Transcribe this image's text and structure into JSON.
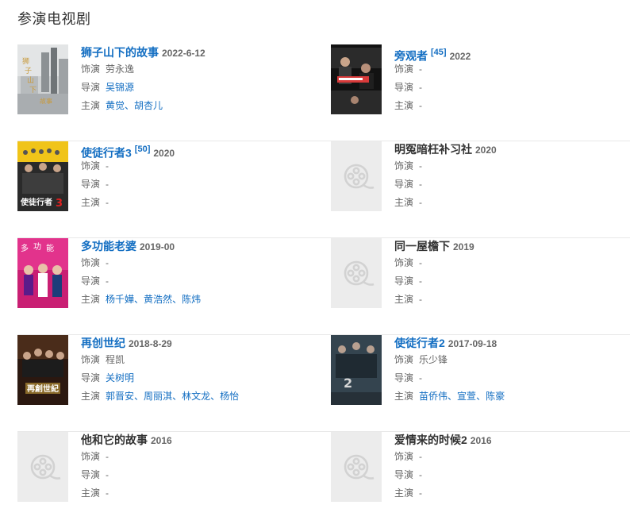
{
  "section": {
    "title": "参演电视剧"
  },
  "labels": {
    "role": "饰演",
    "director": "导演",
    "cast": "主演"
  },
  "dramas": [
    {
      "title": "狮子山下的故事",
      "ref": "",
      "date": "2022-6-12",
      "role": "劳永逸",
      "director": "吴锦源",
      "cast": [
        "黄觉",
        "胡杏儿"
      ],
      "poster": "lion-rock"
    },
    {
      "title": "旁观者",
      "ref": "[45]",
      "date": "2022",
      "role": "-",
      "director": "-",
      "cast": [
        "-"
      ],
      "poster": "bystander"
    },
    {
      "title": "使徒行者3",
      "ref": "[50]",
      "date": "2020",
      "role": "-",
      "director": "-",
      "cast": [
        "-"
      ],
      "poster": "line-walker-3"
    },
    {
      "title": "明冤暗枉补习社",
      "ref": "",
      "date": "2020",
      "role": "-",
      "director": "-",
      "cast": [
        "-"
      ],
      "poster": "placeholder"
    },
    {
      "title": "多功能老婆",
      "ref": "",
      "date": "2019-00",
      "role": "-",
      "director": "-",
      "cast": [
        "杨千嬅",
        "黄浩然",
        "陈炜"
      ],
      "poster": "wife"
    },
    {
      "title": "同一屋檐下",
      "ref": "",
      "date": "2019",
      "role": "-",
      "director": "-",
      "cast": [
        "-"
      ],
      "poster": "placeholder"
    },
    {
      "title": "再创世纪",
      "ref": "",
      "date": "2018-8-29",
      "role": "程凯",
      "director": "关树明",
      "cast": [
        "郭晋安",
        "周丽淇",
        "林文龙",
        "杨怡"
      ],
      "poster": "another-era"
    },
    {
      "title": "使徒行者2",
      "ref": "",
      "date": "2017-09-18",
      "role": "乐少锋",
      "director": "-",
      "cast": [
        "苗侨伟",
        "宣萱",
        "陈豪"
      ],
      "poster": "line-walker-2"
    },
    {
      "title": "他和它的故事",
      "ref": "",
      "date": "2016",
      "role": "-",
      "director": "-",
      "cast": [
        "-"
      ],
      "poster": "placeholder"
    },
    {
      "title": "爱情来的时候2",
      "ref": "",
      "date": "2016",
      "role": "-",
      "director": "-",
      "cast": [
        "-"
      ],
      "poster": "placeholder"
    }
  ],
  "colors": {
    "link": "#136ec2",
    "text": "#333333",
    "muted": "#666666",
    "divider": "#e8e8e8",
    "placeholder_bg": "#ececec"
  }
}
